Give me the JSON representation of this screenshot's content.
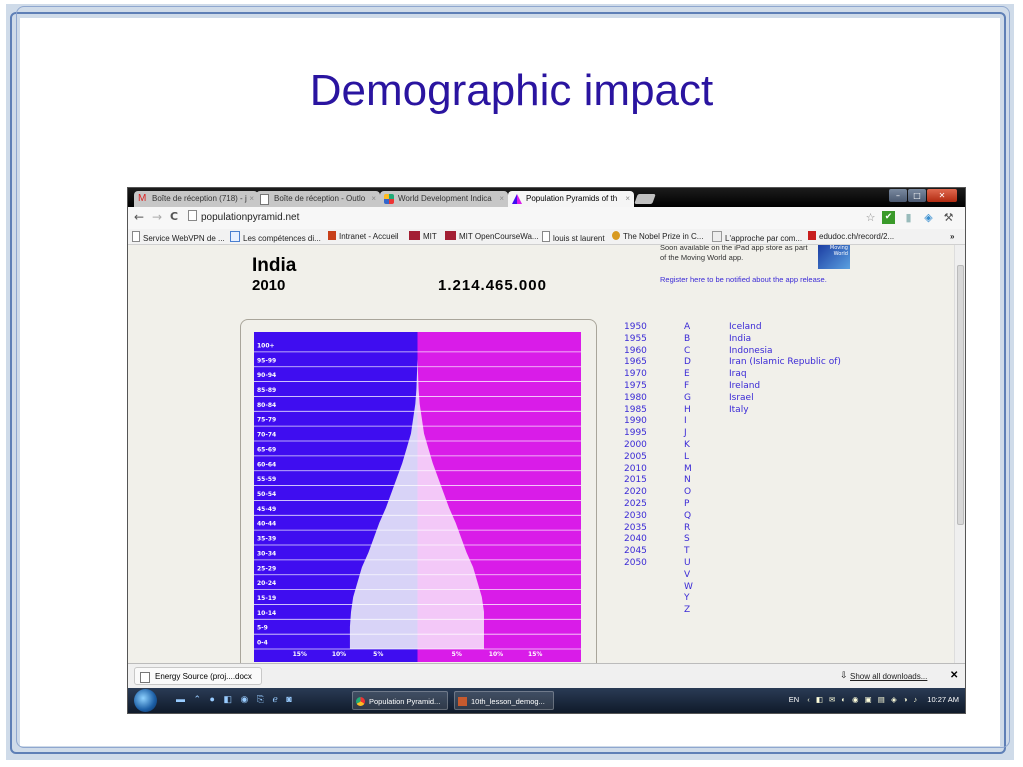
{
  "slide": {
    "title": "Demographic impact"
  },
  "browser": {
    "tabs": [
      {
        "label": "Boîte de réception (718) - j",
        "icon": "gmail-icon"
      },
      {
        "label": "Boîte de réception - Outlo",
        "icon": "page-icon"
      },
      {
        "label": "World Development Indica",
        "icon": "world-icon"
      },
      {
        "label": "Population Pyramids of th",
        "icon": "pyramid-icon"
      }
    ],
    "url": "populationpyramid.net",
    "bookmarks": [
      {
        "label": "Service WebVPN de ..."
      },
      {
        "label": "Les compétences di..."
      },
      {
        "label": "Intranet - Accueil"
      },
      {
        "label": "MIT"
      },
      {
        "label": "MIT OpenCourseWa..."
      },
      {
        "label": "louis st laurent"
      },
      {
        "label": "The Nobel Prize in C..."
      },
      {
        "label": "L'approche par com..."
      },
      {
        "label": "edudoc.ch/record/2..."
      }
    ],
    "bookmarks_more": "»"
  },
  "page": {
    "country": "India",
    "year": "2010",
    "population": "1.214.465.000",
    "promo_text": "Soon available on the iPad app store as part of the Moving World app.",
    "promo_link": "Register here to be notified about the app release.",
    "app_thumb_label": "Moving World",
    "years": [
      "1950",
      "1955",
      "1960",
      "1965",
      "1970",
      "1975",
      "1980",
      "1985",
      "1990",
      "1995",
      "2000",
      "2005",
      "2010",
      "2015",
      "2020",
      "2025",
      "2030",
      "2035",
      "2040",
      "2045",
      "2050"
    ],
    "letters": [
      "A",
      "B",
      "C",
      "D",
      "E",
      "F",
      "G",
      "H",
      "I",
      "J",
      "K",
      "L",
      "M",
      "N",
      "O",
      "P",
      "Q",
      "R",
      "S",
      "T",
      "U",
      "V",
      "W",
      "Y",
      "Z"
    ],
    "countries": [
      "Iceland",
      "India",
      "Indonesia",
      "Iran (Islamic Republic of)",
      "Iraq",
      "Ireland",
      "Israel",
      "Italy"
    ]
  },
  "chart_data": {
    "type": "bar",
    "title": "",
    "orientation": "horizontal-pyramid",
    "categories": [
      "100+",
      "95-99",
      "90-94",
      "85-89",
      "80-84",
      "75-79",
      "70-74",
      "65-69",
      "60-64",
      "55-59",
      "50-54",
      "45-49",
      "40-44",
      "35-39",
      "30-34",
      "25-29",
      "20-24",
      "15-19",
      "10-14",
      "5-9",
      "0-4"
    ],
    "series": [
      {
        "side": "left",
        "values": [
          0.0,
          0.0,
          0.05,
          0.1,
          0.2,
          0.4,
          0.6,
          1.0,
          1.4,
          1.9,
          2.4,
          2.9,
          3.5,
          4.0,
          4.5,
          5.1,
          5.5,
          5.9,
          6.1,
          6.2,
          6.2
        ]
      },
      {
        "side": "right",
        "values": [
          0.0,
          0.0,
          0.05,
          0.1,
          0.2,
          0.4,
          0.6,
          1.0,
          1.4,
          1.9,
          2.4,
          2.9,
          3.5,
          4.0,
          4.5,
          5.1,
          5.5,
          5.9,
          6.1,
          6.1,
          6.1
        ]
      }
    ],
    "x_ticks": [
      "15%",
      "10%",
      "5%",
      "5%",
      "10%",
      "15%"
    ],
    "xlim": [
      0,
      15
    ],
    "colors": {
      "left_background": "#3f0df0",
      "left_fill": "#d8d3f7",
      "right_background": "#d91ce8",
      "right_fill": "#f3c8f8"
    }
  },
  "downloads": {
    "item": "Energy Source (proj....docx",
    "show_all": "Show all downloads..."
  },
  "taskbar": {
    "tasks": [
      "Population Pyramid...",
      "10th_lesson_demog..."
    ],
    "tray_lang": "EN",
    "clock": "10:27 AM"
  }
}
